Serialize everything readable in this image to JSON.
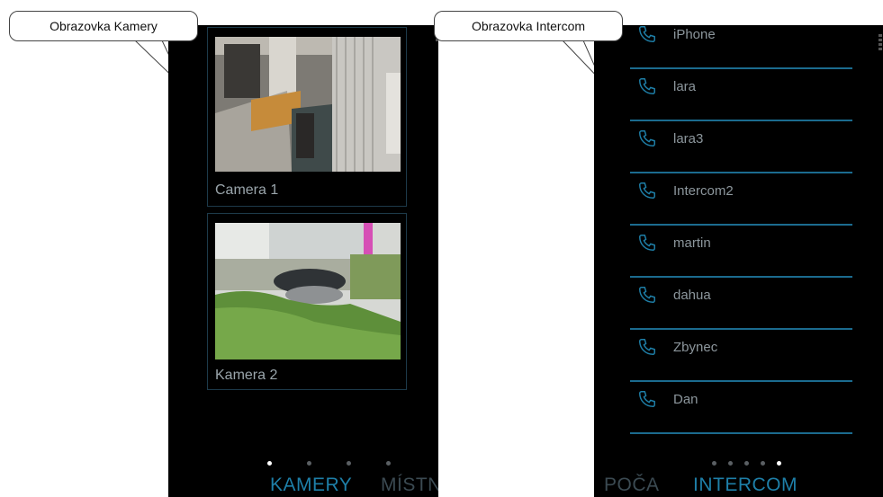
{
  "callouts": {
    "left": "Obrazovka Kamery",
    "right": "Obrazovka Intercom"
  },
  "camera_screen": {
    "cameras": [
      {
        "label": "Camera 1"
      },
      {
        "label": "Kamera 2"
      }
    ],
    "page_dots": {
      "count": 4,
      "active_index": 0
    },
    "tabs": {
      "active": "KAMERY",
      "next": "MÍSTN"
    }
  },
  "intercom_screen": {
    "contacts": [
      {
        "name": "iPhone"
      },
      {
        "name": "lara"
      },
      {
        "name": "lara3"
      },
      {
        "name": "Intercom2"
      },
      {
        "name": "martin"
      },
      {
        "name": "dahua"
      },
      {
        "name": "Zbynec"
      },
      {
        "name": "Dan"
      }
    ],
    "page_dots": {
      "count": 5,
      "active_index": 4
    },
    "tabs": {
      "previous": "POČA",
      "active": "INTERCOM"
    }
  },
  "colors": {
    "accent": "#1e7fa8",
    "divider": "#1b6b8f",
    "screen_bg": "#000000"
  },
  "icons": {
    "contact": "phone-icon",
    "menu": "overflow-menu-icon"
  }
}
